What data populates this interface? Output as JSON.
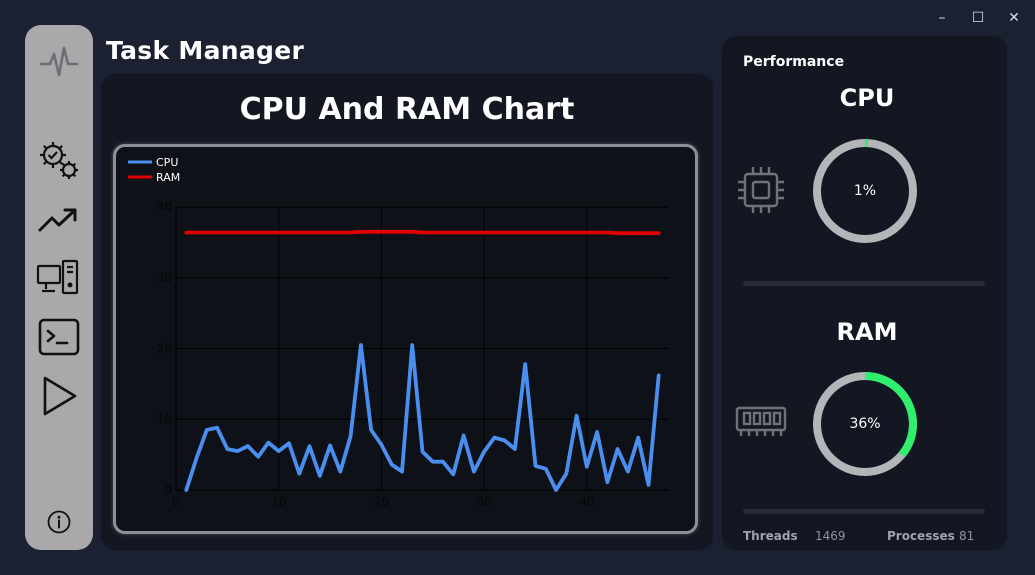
{
  "window": {
    "minimize_glyph": "–",
    "maximize_glyph": "☐",
    "close_glyph": "✕"
  },
  "app": {
    "title": "Task Manager"
  },
  "sidebar": {
    "icons": [
      "activity-logo-icon",
      "settings-gears-icon",
      "trending-up-icon",
      "computer-tower-icon",
      "terminal-icon",
      "play-icon",
      "info-icon"
    ]
  },
  "main": {
    "heading": "CPU And RAM Chart"
  },
  "chart_data": {
    "type": "line",
    "xlim": [
      0,
      48
    ],
    "ylim": [
      0,
      40
    ],
    "xticks": [
      0,
      10,
      20,
      30,
      40
    ],
    "yticks": [
      0,
      10,
      20,
      30,
      40
    ],
    "grid": true,
    "legend_position": "top-left",
    "series": [
      {
        "name": "CPU",
        "color": "#4a8ff0",
        "x": [
          1,
          2,
          3,
          4,
          5,
          6,
          7,
          8,
          9,
          10,
          11,
          12,
          13,
          14,
          15,
          16,
          17,
          18,
          19,
          20,
          21,
          22,
          23,
          24,
          25,
          26,
          27,
          28,
          29,
          30,
          31,
          32,
          33,
          34,
          35,
          36,
          37,
          38,
          39,
          40,
          41,
          42,
          43,
          44,
          45,
          46,
          47
        ],
        "values": [
          0,
          4.5,
          8.5,
          8.8,
          5.8,
          5.5,
          6.2,
          4.7,
          6.7,
          5.5,
          6.6,
          2.3,
          6.2,
          2,
          6.3,
          2.6,
          7.6,
          20.5,
          8.5,
          6.4,
          3.6,
          2.6,
          20.5,
          5.4,
          4,
          4,
          2.2,
          7.7,
          2.6,
          5.4,
          7.4,
          7,
          5.8,
          17.8,
          3.4,
          3,
          0,
          2.3,
          10.5,
          3.3,
          8.2,
          1.1,
          5.8,
          2.6,
          7.4,
          0.7,
          16.2
        ]
      },
      {
        "name": "RAM",
        "color": "#e00000",
        "x": [
          1,
          2,
          3,
          4,
          5,
          6,
          7,
          8,
          9,
          10,
          11,
          12,
          13,
          14,
          15,
          16,
          17,
          18,
          19,
          20,
          21,
          22,
          23,
          24,
          25,
          26,
          27,
          28,
          29,
          30,
          31,
          32,
          33,
          34,
          35,
          36,
          37,
          38,
          39,
          40,
          41,
          42,
          43,
          44,
          45,
          46,
          47
        ],
        "values": [
          36.4,
          36.4,
          36.4,
          36.4,
          36.4,
          36.4,
          36.4,
          36.4,
          36.4,
          36.4,
          36.4,
          36.4,
          36.4,
          36.4,
          36.4,
          36.4,
          36.4,
          36.5,
          36.5,
          36.5,
          36.5,
          36.5,
          36.5,
          36.4,
          36.4,
          36.4,
          36.4,
          36.4,
          36.4,
          36.4,
          36.4,
          36.4,
          36.4,
          36.4,
          36.4,
          36.4,
          36.4,
          36.4,
          36.4,
          36.4,
          36.4,
          36.4,
          36.3,
          36.3,
          36.3,
          36.3,
          36.3
        ]
      }
    ]
  },
  "performance": {
    "title": "Performance",
    "cpu": {
      "label": "CPU",
      "value_text": "1%",
      "percent": 1,
      "icon": "cpu-chip-icon"
    },
    "ram": {
      "label": "RAM",
      "value_text": "36%",
      "percent": 36,
      "icon": "ram-module-icon"
    },
    "ring_track_color": "#b3b5b9",
    "ring_fill_color": "#2ef06d",
    "threads": {
      "label": "Threads",
      "value": "1469"
    },
    "processes": {
      "label": "Processes",
      "value": "81"
    }
  }
}
